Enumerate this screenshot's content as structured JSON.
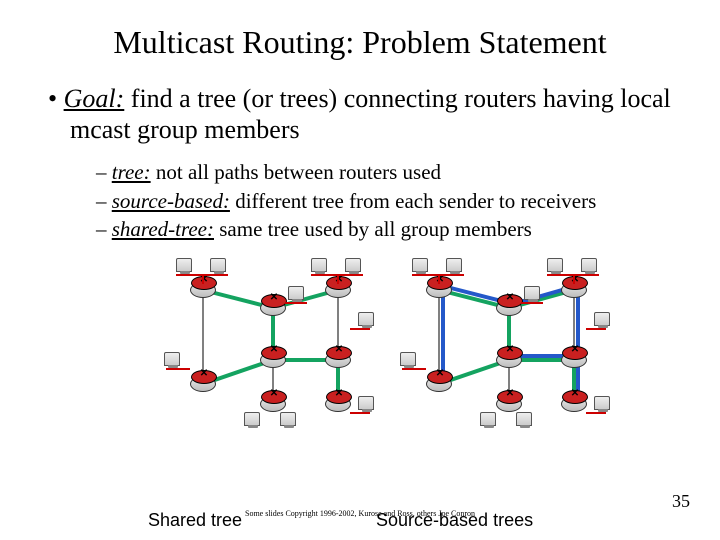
{
  "title": "Multicast Routing: Problem Statement",
  "goal_label": "Goal:",
  "goal_text": " find a tree (or trees) connecting routers having local mcast group members",
  "sub": {
    "tree_term": "tree:",
    "tree_text": " not all paths between routers used",
    "src_term": "source-based:",
    "src_text": " different tree from each sender to receivers",
    "sh_term": "shared-tree:",
    "sh_text": " same tree used by all group members"
  },
  "captions": {
    "left": "Shared tree",
    "right": "Source-based trees"
  },
  "copyright": "Some slides Copyright 1996-2002, Kurose and Ross, others Joe Conron",
  "page": "35"
}
